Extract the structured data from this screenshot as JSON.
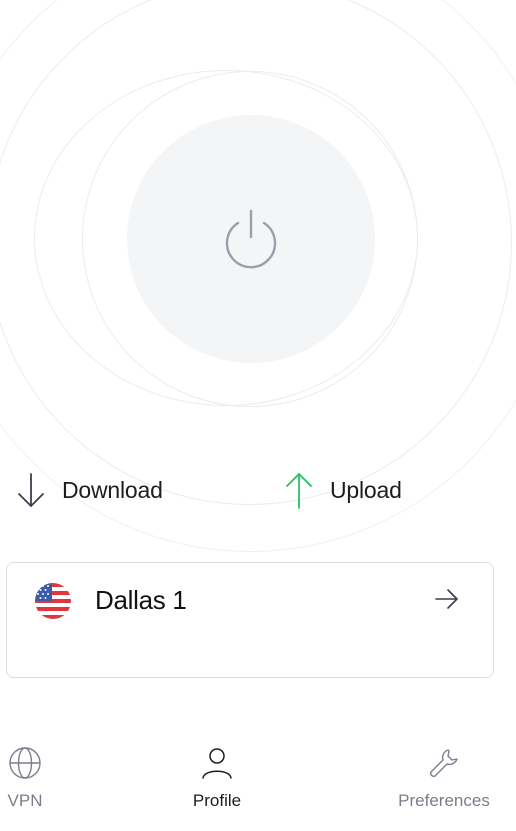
{
  "stats": {
    "download_label": "Download",
    "upload_label": "Upload"
  },
  "server": {
    "name": "Dallas 1",
    "flag_icon": "us-flag-icon"
  },
  "nav": {
    "items": [
      {
        "label": "VPN",
        "icon": "globe-icon",
        "active": false
      },
      {
        "label": "Profile",
        "icon": "user-icon",
        "active": true
      },
      {
        "label": "Preferences",
        "icon": "wrench-icon",
        "active": false
      }
    ]
  },
  "colors": {
    "upload_arrow": "#22c55e",
    "download_arrow": "#3b3f4a",
    "power_icon": "#9aa0ab",
    "power_bg": "#f4f5f7",
    "text_primary": "#1c1d21",
    "text_muted": "#7a7e8a"
  }
}
